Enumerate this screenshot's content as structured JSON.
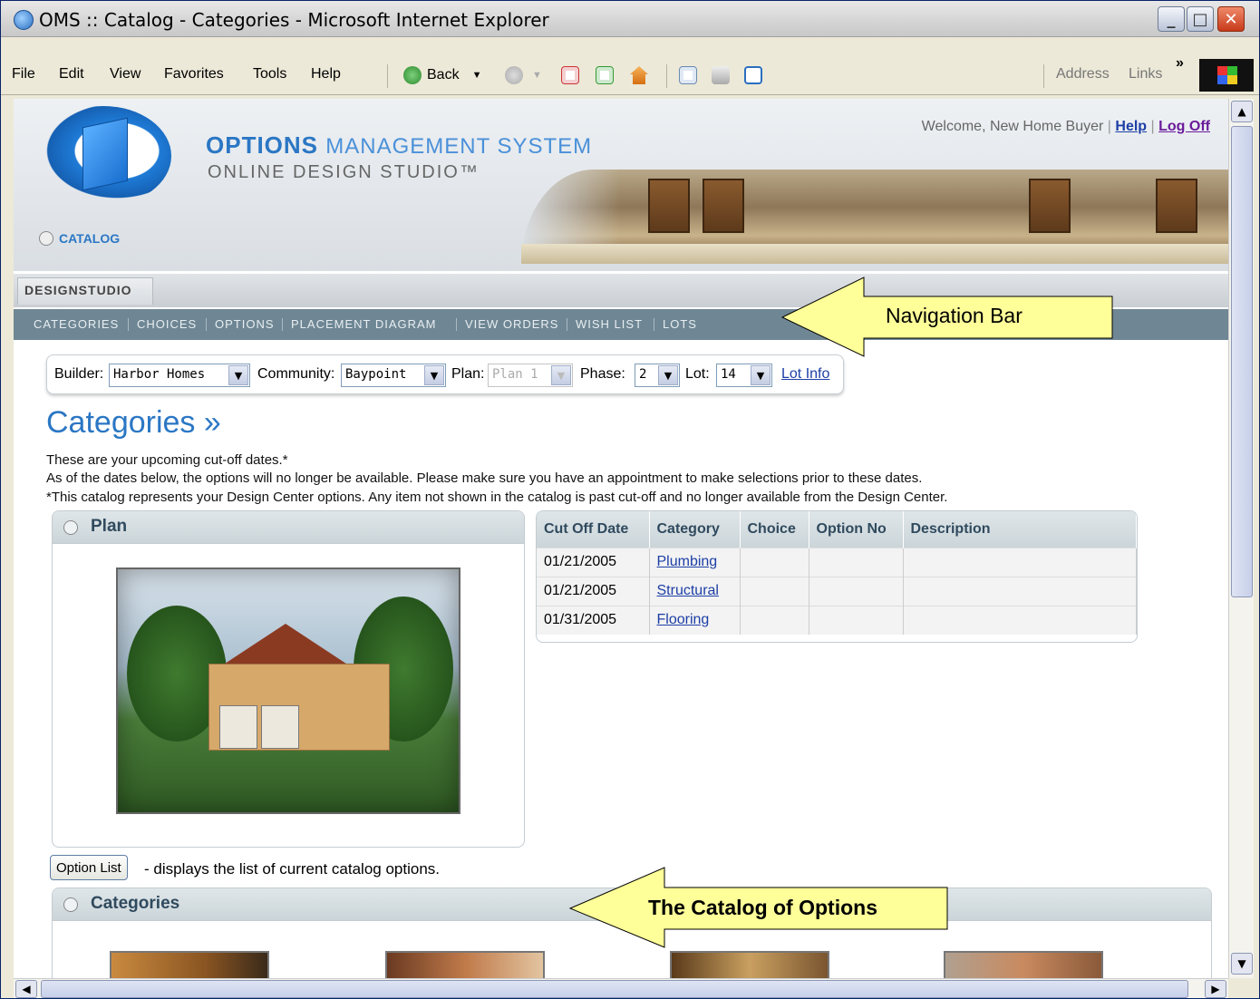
{
  "window": {
    "title": "OMS :: Catalog - Categories - Microsoft Internet Explorer",
    "controls": {
      "minimize": "_",
      "maximize": "□",
      "close": "✕"
    }
  },
  "menu": {
    "items": [
      "File",
      "Edit",
      "View",
      "Favorites",
      "Tools",
      "Help"
    ]
  },
  "toolbar": {
    "back_label": "Back",
    "address_label": "Address",
    "links_label": "Links",
    "more": "»"
  },
  "header": {
    "title_bold": "OPTIONS",
    "title_rest": "MANAGEMENT SYSTEM",
    "subtitle": "ONLINE DESIGN STUDIO™",
    "welcome": "Welcome, New Home Buyer",
    "help_link": "Help",
    "logoff_link": "Log Off",
    "tab": "CATALOG"
  },
  "studio_bar": {
    "label": "DESIGNSTUDIO"
  },
  "nav": {
    "items": [
      "CATEGORIES",
      "CHOICES",
      "OPTIONS",
      "PLACEMENT DIAGRAM",
      "VIEW ORDERS",
      "WISH LIST",
      "LOTS"
    ]
  },
  "selectors": {
    "builder": {
      "label": "Builder:",
      "value": "Harbor Homes"
    },
    "community": {
      "label": "Community:",
      "value": "Baypoint"
    },
    "plan": {
      "label": "Plan:",
      "value": "Plan 1"
    },
    "phase": {
      "label": "Phase:",
      "value": "2"
    },
    "lot": {
      "label": "Lot:",
      "value": "14"
    },
    "lot_info": "Lot Info"
  },
  "page": {
    "title": "Categories »",
    "intro_line1": "These are your upcoming cut-off dates.*",
    "intro_line2": "As of the dates below, the options will no longer be available. Please make sure you have an appointment to make selections prior to these dates.",
    "intro_line3": "*This catalog represents your Design Center options. Any item not shown in the catalog is past cut-off and no longer available from the Design Center."
  },
  "plan_panel": {
    "title": "Plan"
  },
  "cutoff_table": {
    "headers": [
      "Cut Off Date",
      "Category",
      "Choice",
      "Option No",
      "Description"
    ],
    "rows": [
      {
        "date": "01/21/2005",
        "category": "Plumbing",
        "choice": "",
        "option_no": "",
        "description": ""
      },
      {
        "date": "01/21/2005",
        "category": "Structural",
        "choice": "",
        "option_no": "",
        "description": ""
      },
      {
        "date": "01/31/2005",
        "category": "Flooring",
        "choice": "",
        "option_no": "",
        "description": ""
      }
    ]
  },
  "option_list": {
    "button": "Option List",
    "description": "- displays the list of current catalog options."
  },
  "categories_panel": {
    "title": "Categories"
  },
  "callouts": {
    "navigation": "Navigation Bar",
    "catalog": "The Catalog of Options"
  },
  "colors": {
    "brand_blue": "#2b77c4",
    "nav_bg": "#6f8794",
    "callout_fill": "#ffff99",
    "link": "#1d3fa6"
  }
}
